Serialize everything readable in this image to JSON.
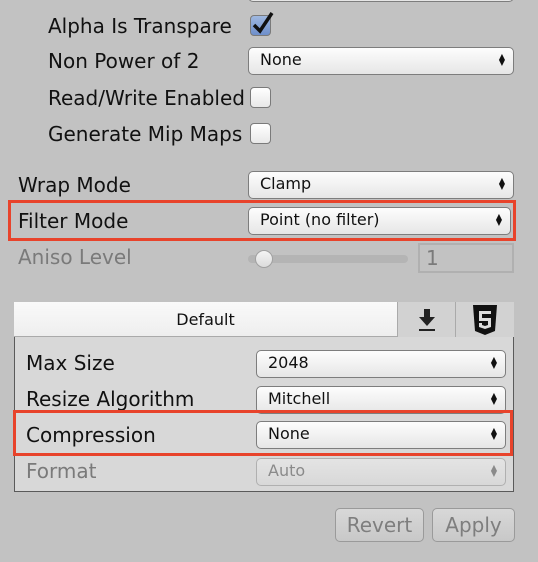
{
  "settings": {
    "alpha_is_transparency": {
      "label": "Alpha Is Transpare",
      "checked": true
    },
    "non_power_of_2": {
      "label": "Non Power of 2",
      "value": "None"
    },
    "read_write_enabled": {
      "label": "Read/Write Enabled",
      "checked": false
    },
    "generate_mip_maps": {
      "label": "Generate Mip Maps",
      "checked": false
    },
    "wrap_mode": {
      "label": "Wrap Mode",
      "value": "Clamp"
    },
    "filter_mode": {
      "label": "Filter Mode",
      "value": "Point (no filter)"
    },
    "aniso_level": {
      "label": "Aniso Level",
      "value": "1",
      "slider_fraction": 0.0
    }
  },
  "platform_panel": {
    "tabs": [
      {
        "label": "Default",
        "active": true
      },
      {
        "icon": "download-icon"
      },
      {
        "icon": "html5-icon"
      }
    ],
    "max_size": {
      "label": "Max Size",
      "value": "2048"
    },
    "resize_algorithm": {
      "label": "Resize Algorithm",
      "value": "Mitchell"
    },
    "compression": {
      "label": "Compression",
      "value": "None"
    },
    "format": {
      "label": "Format",
      "value": "Auto"
    }
  },
  "buttons": {
    "revert": "Revert",
    "apply": "Apply"
  },
  "highlight_color": "#e8432b"
}
